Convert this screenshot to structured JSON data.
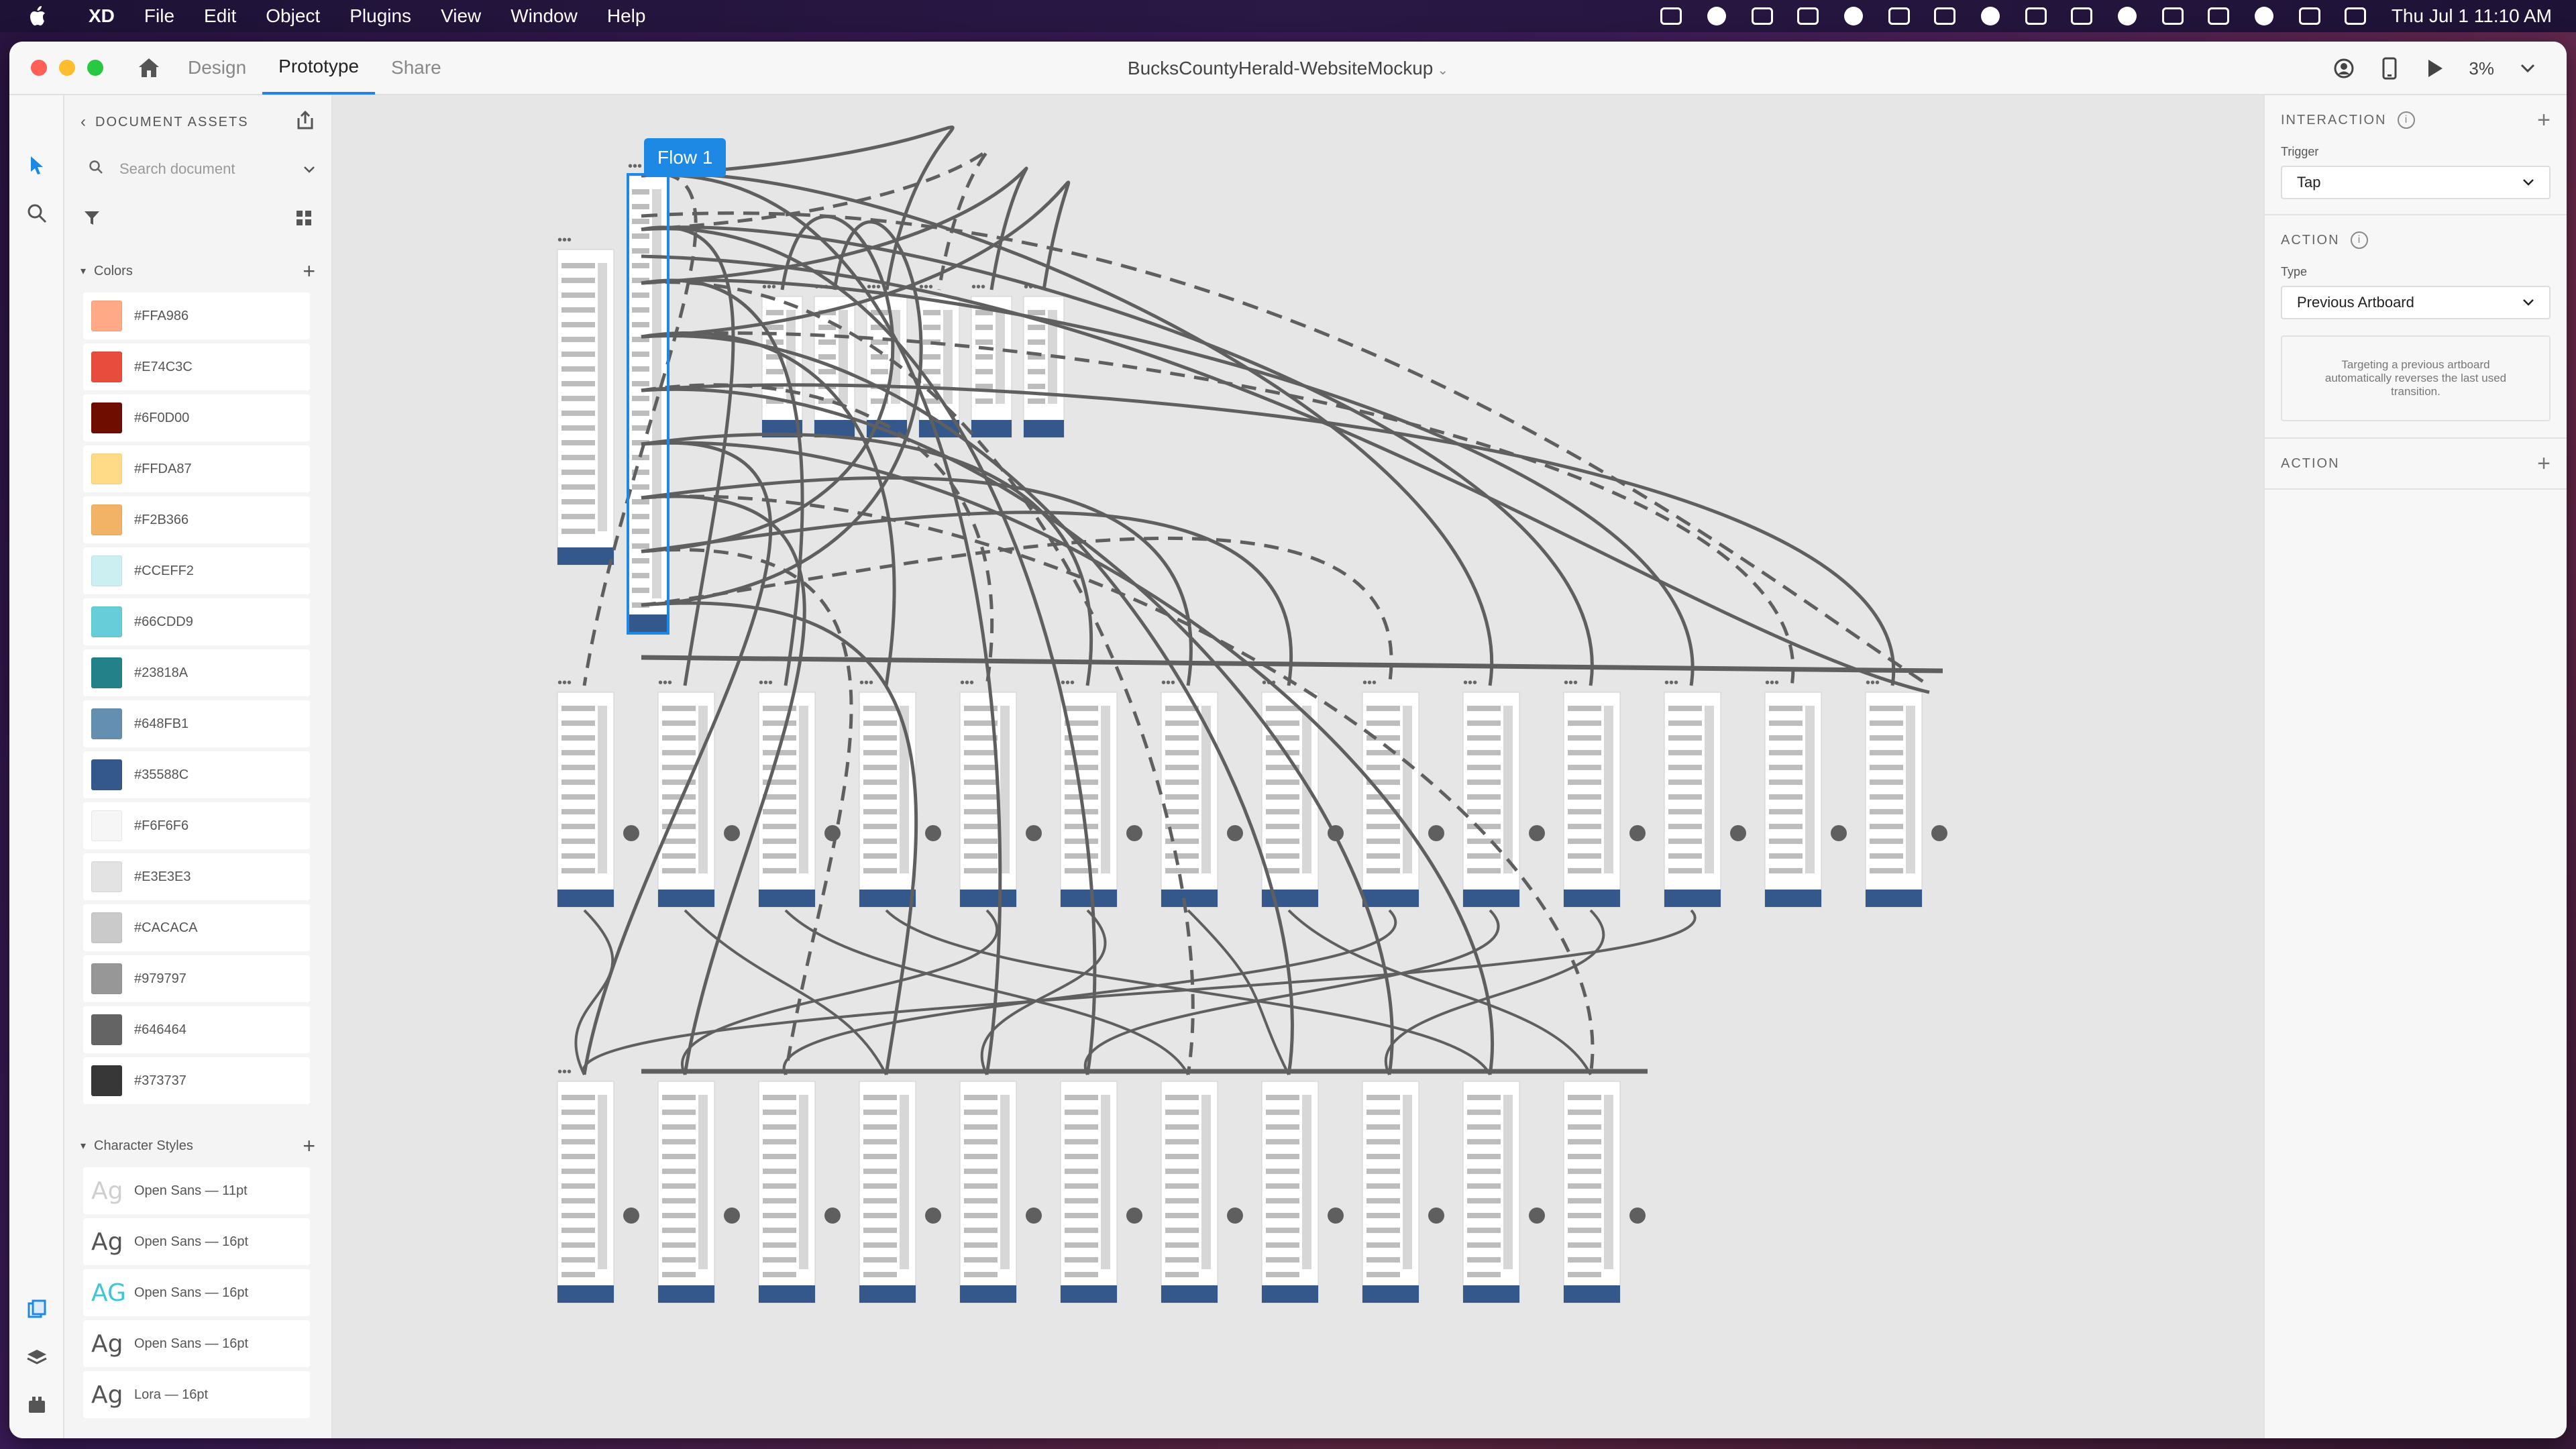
{
  "menubar": {
    "app_name": "XD",
    "items": [
      "File",
      "Edit",
      "Object",
      "Plugins",
      "View",
      "Window",
      "Help"
    ],
    "clock": "Thu Jul 1  11:10 AM",
    "status_icons": [
      "creative-cloud-icon",
      "binoculars-icon",
      "display-icon",
      "dropbox-icon",
      "app-icon",
      "cloud-icon",
      "airplay-icon",
      "volume-icon",
      "battery-menu-icon",
      "bluetooth-icon",
      "battery-icon",
      "wifi-icon",
      "user-icon",
      "spotlight-icon",
      "control-center-icon",
      "siri-icon"
    ]
  },
  "window": {
    "tabs": [
      "Design",
      "Prototype",
      "Share"
    ],
    "active_tab": "Prototype",
    "doc_title": "BucksCountyHerald-WebsiteMockup",
    "zoom": "3%"
  },
  "assets": {
    "header": "DOCUMENT ASSETS",
    "search_placeholder": "Search document",
    "colors_title": "Colors",
    "colors": [
      {
        "hex": "#FFA986",
        "label": "#FFA986"
      },
      {
        "hex": "#E74C3C",
        "label": "#E74C3C"
      },
      {
        "hex": "#6F0D00",
        "label": "#6F0D00"
      },
      {
        "hex": "#FFDA87",
        "label": "#FFDA87"
      },
      {
        "hex": "#F2B366",
        "label": "#F2B366"
      },
      {
        "hex": "#CCEFF2",
        "label": "#CCEFF2"
      },
      {
        "hex": "#66CDD9",
        "label": "#66CDD9"
      },
      {
        "hex": "#23818A",
        "label": "#23818A"
      },
      {
        "hex": "#648FB1",
        "label": "#648FB1"
      },
      {
        "hex": "#35588C",
        "label": "#35588C"
      },
      {
        "hex": "#F6F6F6",
        "label": "#F6F6F6"
      },
      {
        "hex": "#E3E3E3",
        "label": "#E3E3E3"
      },
      {
        "hex": "#CACACA",
        "label": "#CACACA"
      },
      {
        "hex": "#979797",
        "label": "#979797"
      },
      {
        "hex": "#646464",
        "label": "#646464"
      },
      {
        "hex": "#373737",
        "label": "#373737"
      }
    ],
    "char_styles_title": "Character Styles",
    "char_styles": [
      {
        "sample": "Ag",
        "label": "Open Sans — 11pt",
        "color": "#cfcfcf"
      },
      {
        "sample": "Ag",
        "label": "Open Sans — 16pt",
        "color": "#555555"
      },
      {
        "sample": "AG",
        "label": "Open Sans — 16pt",
        "color": "#3ec6d6"
      },
      {
        "sample": "Ag",
        "label": "Open Sans — 16pt",
        "color": "#555555"
      },
      {
        "sample": "Ag",
        "label": "Lora — 16pt",
        "color": "#555555"
      }
    ]
  },
  "canvas": {
    "flow_label": "Flow 1",
    "accent": "#1e88e5",
    "wire_color": "#5f5f5f"
  },
  "inspector": {
    "interaction_title": "INTERACTION",
    "trigger_label": "Trigger",
    "trigger_value": "Tap",
    "action_title": "ACTION",
    "type_label": "Type",
    "type_value": "Previous Artboard",
    "note": "Targeting a previous artboard automatically reverses the last used transition.",
    "action2_title": "ACTION"
  }
}
